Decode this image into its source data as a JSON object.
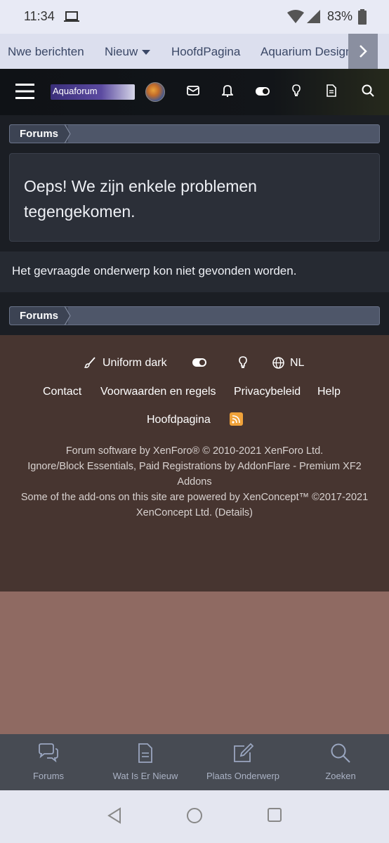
{
  "status_bar": {
    "time": "11:34",
    "battery": "83%"
  },
  "nav_tabs": [
    {
      "label": "Nwe berichten"
    },
    {
      "label": "Nieuw"
    },
    {
      "label": "HoofdPagina"
    },
    {
      "label": "Aquarium Design Sho"
    }
  ],
  "header": {
    "logo_text": "Aquaforum"
  },
  "breadcrumb": {
    "label": "Forums"
  },
  "error": {
    "title": "Oeps! We zijn enkele problemen tegengekomen.",
    "message": "Het gevraagde onderwerp kon niet gevonden worden."
  },
  "breadcrumb_bottom": {
    "label": "Forums"
  },
  "footer": {
    "style_label": "Uniform dark",
    "language": "NL",
    "links": [
      "Contact",
      "Voorwaarden en regels",
      "Privacybeleid",
      "Help"
    ],
    "home": "Hoofdpagina",
    "legal_1": "Forum software by XenForo® © 2010-2021 XenForo Ltd.",
    "legal_2": "Ignore/Block Essentials, Paid Registrations by AddonFlare - Premium XF2",
    "legal_3": "Addons",
    "legal_4": "Some of the add-ons on this site are powered by XenConcept™ ©2017-2021",
    "legal_5": "XenConcept Ltd. (Details)"
  },
  "bottom_nav": [
    {
      "label": "Forums",
      "icon": "chat-icon"
    },
    {
      "label": "Wat Is Er Nieuw",
      "icon": "document-icon"
    },
    {
      "label": "Plaats Onderwerp",
      "icon": "edit-icon"
    },
    {
      "label": "Zoeken",
      "icon": "search-icon"
    }
  ],
  "colors": {
    "footer_bg": "#473530",
    "footer_fill": "#8f6a62",
    "breadcrumb": "#4e5669",
    "error_block": "#2b2f38"
  }
}
